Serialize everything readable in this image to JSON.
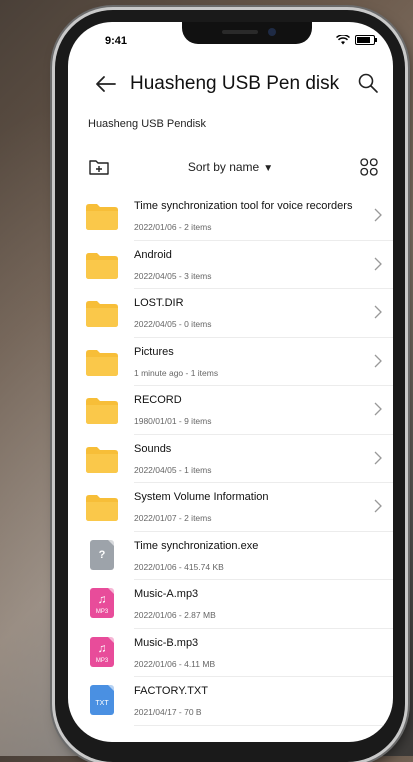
{
  "status": {
    "time": "9:41"
  },
  "header": {
    "title": "Huasheng USB Pen disk"
  },
  "breadcrumb": "Huasheng USB Pendisk",
  "toolbar": {
    "sort_label": "Sort by name"
  },
  "colors": {
    "folder": "#F7BE38",
    "exe": "#9DA3AA",
    "mp3": "#E84C9A",
    "txt": "#4A90E2"
  },
  "items": [
    {
      "name": "Time synchronization tool for voice recorders",
      "meta": "2022/01/06 - 2 items",
      "kind": "folder",
      "icon": "folder-icon"
    },
    {
      "name": "Android",
      "meta": "2022/04/05 - 3 items",
      "kind": "folder",
      "icon": "folder-icon"
    },
    {
      "name": "LOST.DIR",
      "meta": "2022/04/05 - 0 items",
      "kind": "folder",
      "icon": "folder-icon"
    },
    {
      "name": "Pictures",
      "meta": "1 minute ago - 1 items",
      "kind": "folder",
      "icon": "folder-icon"
    },
    {
      "name": "RECORD",
      "meta": "1980/01/01 - 9 items",
      "kind": "folder",
      "icon": "folder-icon"
    },
    {
      "name": "Sounds",
      "meta": "2022/04/05 - 1 items",
      "kind": "folder",
      "icon": "folder-icon"
    },
    {
      "name": "System Volume Information",
      "meta": "2022/01/07 - 2 items",
      "kind": "folder",
      "icon": "folder-icon"
    },
    {
      "name": "Time synchronization.exe",
      "meta": "2022/01/06 - 415.74 KB",
      "kind": "exe",
      "icon": "unknown-file-icon",
      "glyph": "?"
    },
    {
      "name": "Music-A.mp3",
      "meta": "2022/01/06 - 2.87 MB",
      "kind": "mp3",
      "icon": "music-file-icon",
      "glyph": "♫",
      "tag": "MP3"
    },
    {
      "name": "Music-B.mp3",
      "meta": "2022/01/06 - 4.11 MB",
      "kind": "mp3",
      "icon": "music-file-icon",
      "glyph": "♫",
      "tag": "MP3"
    },
    {
      "name": "FACTORY.TXT",
      "meta": "2021/04/17 - 70 B",
      "kind": "txt",
      "icon": "text-file-icon",
      "glyph": "",
      "tag": "TXT"
    }
  ]
}
